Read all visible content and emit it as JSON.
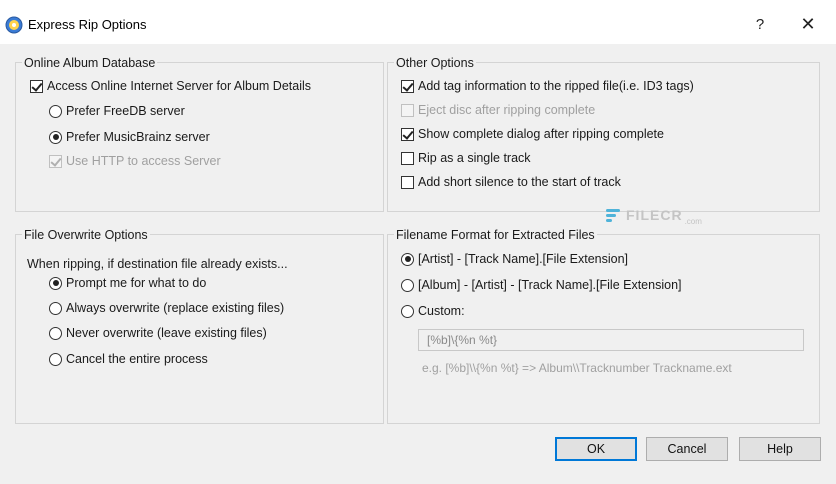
{
  "window": {
    "title": "Express Rip Options",
    "help_glyph": "?",
    "close_glyph": "✕"
  },
  "online_db": {
    "title": "Online Album Database",
    "access_server": {
      "label": "Access Online Internet Server for Album Details",
      "checked": true
    },
    "prefer_freedb": {
      "label": "Prefer FreeDB server",
      "selected": false
    },
    "prefer_musicbrainz": {
      "label": "Prefer MusicBrainz server",
      "selected": true
    },
    "use_http": {
      "label": "Use HTTP to access Server",
      "checked": true,
      "disabled": true
    }
  },
  "other_options": {
    "title": "Other Options",
    "items": [
      {
        "label": "Add tag information to the ripped file(i.e. ID3 tags)",
        "checked": true,
        "disabled": false
      },
      {
        "label": "Eject disc after ripping complete",
        "checked": false,
        "disabled": true
      },
      {
        "label": "Show complete dialog after ripping complete",
        "checked": true,
        "disabled": false
      },
      {
        "label": "Rip as a single track",
        "checked": false,
        "disabled": false
      },
      {
        "label": "Add short silence to the start of track",
        "checked": false,
        "disabled": false
      }
    ]
  },
  "file_overwrite": {
    "title": "File Overwrite Options",
    "prompt_text": "When ripping, if destination file already exists...",
    "options": [
      {
        "label": "Prompt me for what to do",
        "selected": true
      },
      {
        "label": "Always overwrite (replace existing files)",
        "selected": false
      },
      {
        "label": "Never overwrite (leave existing files)",
        "selected": false
      },
      {
        "label": "Cancel the entire process",
        "selected": false
      }
    ]
  },
  "filename_format": {
    "title": "Filename Format for Extracted Files",
    "options": [
      {
        "label": "[Artist] - [Track Name].[File Extension]",
        "selected": true
      },
      {
        "label": "[Album] - [Artist] - [Track Name].[File Extension]",
        "selected": false
      },
      {
        "label": "Custom:",
        "selected": false
      }
    ],
    "custom_value": "[%b]\\{%n %t}",
    "example": "e.g. [%b]\\\\{%n %t}  => Album\\\\Tracknumber Trackname.ext"
  },
  "buttons": {
    "ok": "OK",
    "cancel": "Cancel",
    "help": "Help"
  },
  "watermark": {
    "text": "FILECR",
    "sub": ".com"
  },
  "colors": {
    "accent": "#0078d7",
    "watermark": "#4fb3d9"
  }
}
